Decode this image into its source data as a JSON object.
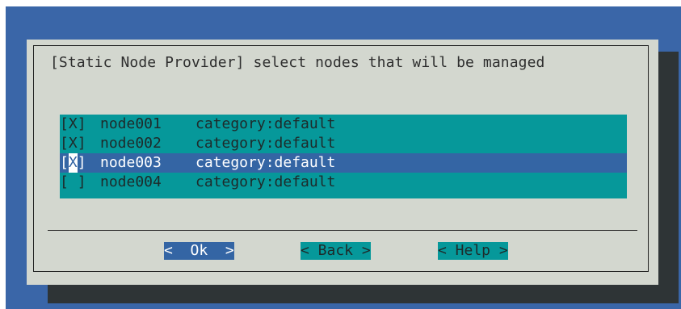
{
  "dialog": {
    "title": "[Static Node Provider] select nodes that will be managed"
  },
  "nodes": [
    {
      "box_open": "[",
      "check": "X",
      "box_close": "]",
      "name": "node001",
      "category": "category:default",
      "checked": true,
      "selected": false
    },
    {
      "box_open": "[",
      "check": "X",
      "box_close": "]",
      "name": "node002",
      "category": "category:default",
      "checked": true,
      "selected": false
    },
    {
      "box_open": "[",
      "check": "X",
      "box_close": "]",
      "name": "node003",
      "category": "category:default",
      "checked": true,
      "selected": true
    },
    {
      "box_open": "[",
      "check": " ",
      "box_close": "]",
      "name": "node004",
      "category": "category:default",
      "checked": false,
      "selected": false
    }
  ],
  "buttons": {
    "ok": "<  Ok  >",
    "back": "< Back >",
    "help": "< Help >"
  },
  "colors": {
    "background": "#3a66a8",
    "dialog": "#d3d7cf",
    "list": "#06989a",
    "selection": "#3465a4",
    "shadow": "#2e3436"
  }
}
